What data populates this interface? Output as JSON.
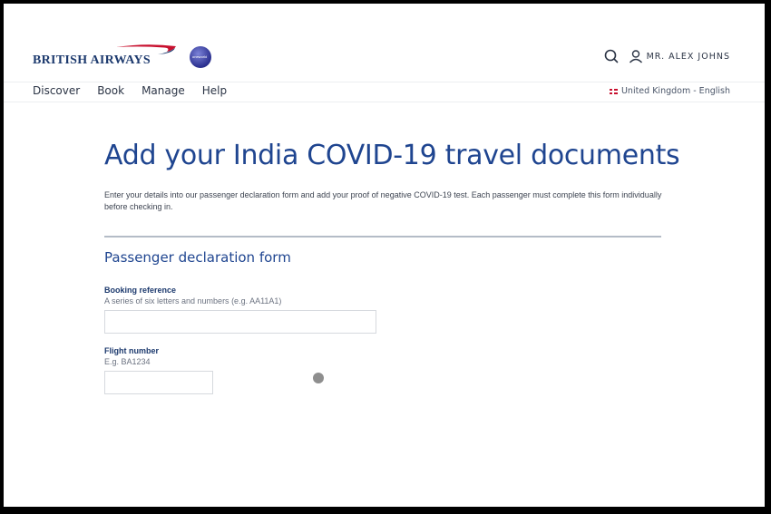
{
  "header": {
    "brand": "BRITISH AIRWAYS",
    "alliance_logo_text": "oneworld",
    "user_name": "MR. ALEX JOHNS",
    "icons": {
      "search": "search-icon",
      "user": "user-icon"
    }
  },
  "nav": {
    "items": [
      {
        "label": "Discover"
      },
      {
        "label": "Book"
      },
      {
        "label": "Manage"
      },
      {
        "label": "Help"
      }
    ],
    "locale": "United Kingdom - English"
  },
  "main": {
    "title": "Add your India COVID-19 travel documents",
    "intro": "Enter your details into our passenger declaration form and add your proof of negative COVID-19 test. Each passenger must complete this form individually before checking in.",
    "section_title": "Passenger declaration form",
    "fields": [
      {
        "label": "Booking reference",
        "hint": "A series of six letters and numbers (e.g. AA11A1)",
        "value": ""
      },
      {
        "label": "Flight number",
        "hint": "E.g. BA1234",
        "value": ""
      }
    ]
  },
  "colors": {
    "brand_navy": "#1d3a6e",
    "title_blue": "#1f4590",
    "swoosh_red": "#c8102e"
  }
}
